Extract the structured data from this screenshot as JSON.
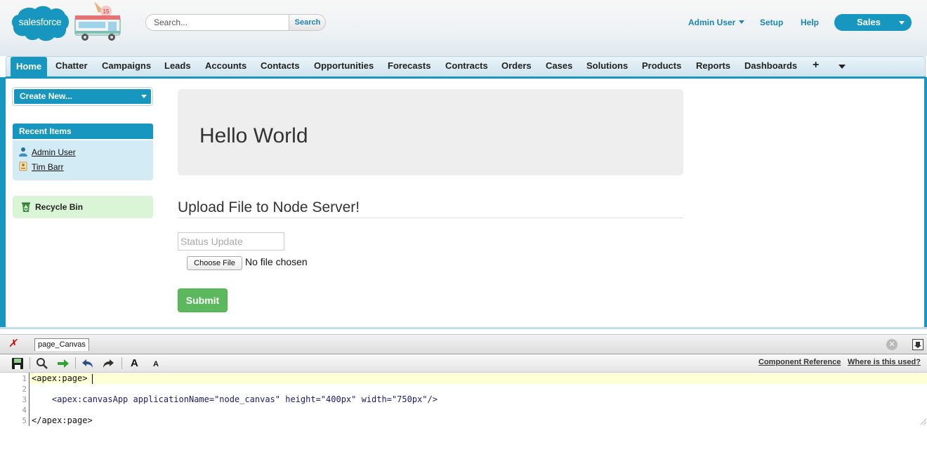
{
  "header": {
    "logo_text": "salesforce",
    "badge_number": "15",
    "search": {
      "placeholder": "Search...",
      "button_label": "Search"
    },
    "user_menu_label": "Admin User",
    "setup_label": "Setup",
    "help_label": "Help",
    "app_picker_label": "Sales"
  },
  "tabs": [
    {
      "label": "Home",
      "active": true
    },
    {
      "label": "Chatter"
    },
    {
      "label": "Campaigns"
    },
    {
      "label": "Leads"
    },
    {
      "label": "Accounts"
    },
    {
      "label": "Contacts"
    },
    {
      "label": "Opportunities"
    },
    {
      "label": "Forecasts"
    },
    {
      "label": "Contracts"
    },
    {
      "label": "Orders"
    },
    {
      "label": "Cases"
    },
    {
      "label": "Solutions"
    },
    {
      "label": "Products"
    },
    {
      "label": "Reports"
    },
    {
      "label": "Dashboards"
    },
    {
      "label": "+"
    }
  ],
  "sidebar": {
    "create_new_label": "Create New...",
    "recent_items_title": "Recent Items",
    "recent_items": [
      {
        "label": "Admin User",
        "icon": "user-icon"
      },
      {
        "label": "Tim Barr",
        "icon": "contact-card-icon"
      }
    ],
    "recycle_bin_label": "Recycle Bin"
  },
  "main": {
    "hero_title": "Hello World",
    "upload_title": "Upload File to Node Server!",
    "status_placeholder": "Status Update",
    "choose_file_label": "Choose File",
    "no_file_text": "No file chosen",
    "submit_label": "Submit"
  },
  "dev_footer": {
    "page_tab_label": "page_Canvas",
    "component_reference_label": "Component Reference",
    "where_used_label": "Where is this used?",
    "font_large_label": "A",
    "font_small_label": "A",
    "line_numbers": [
      "1",
      "2",
      "3",
      "4",
      "5"
    ],
    "code_lines": [
      "<apex:page>",
      "",
      "    <apex:canvasApp applicationName=\"node_canvas\" height=\"400px\" width=\"750px\"/>",
      "",
      "</apex:page>"
    ]
  },
  "colors": {
    "brand_blue": "#1797c0",
    "link_blue": "#1a84b8",
    "submit_green": "#5cb85c",
    "recent_bg": "#d2ebf5",
    "recycle_bg": "#daf5d6"
  }
}
